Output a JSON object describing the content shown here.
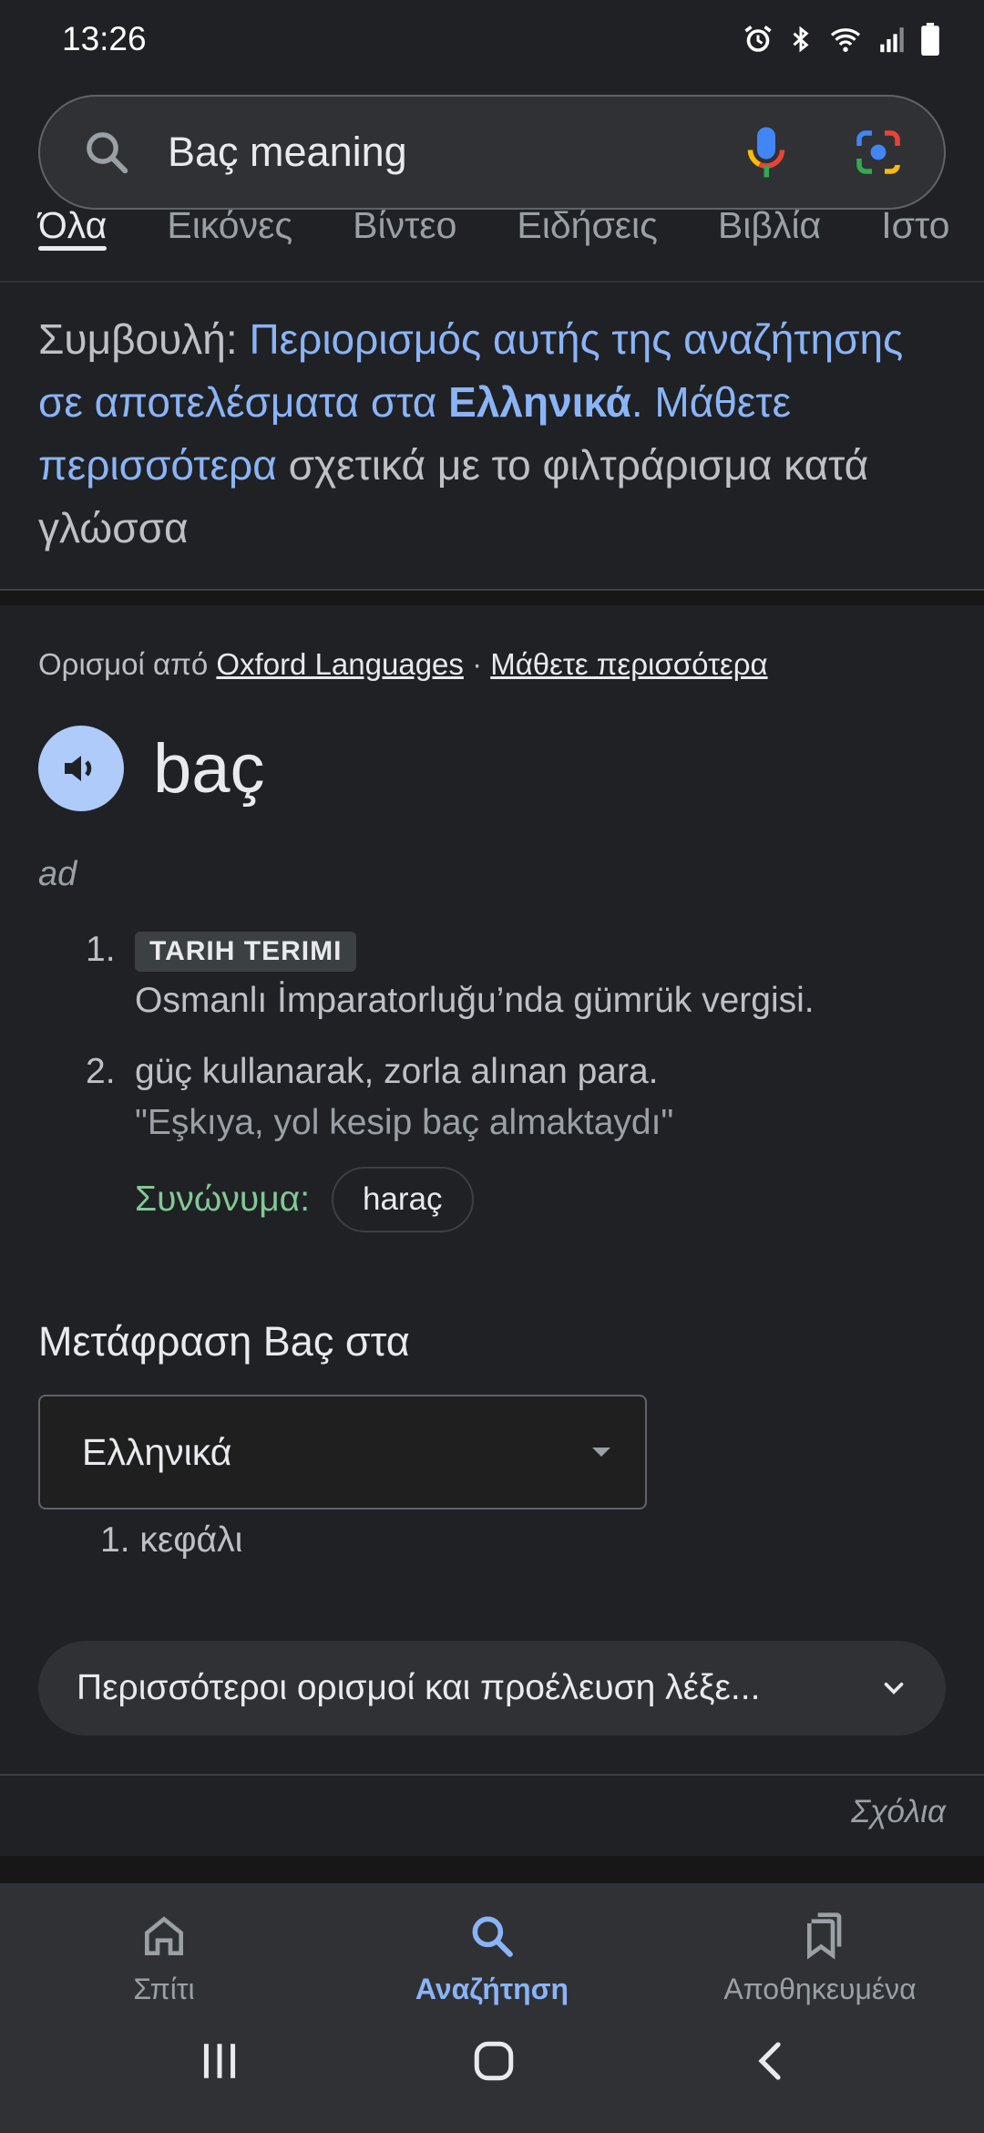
{
  "status_bar": {
    "time": "13:26",
    "icons": [
      "alarm-icon",
      "bluetooth-icon",
      "wifi-icon",
      "signal-icon",
      "battery-icon"
    ]
  },
  "search": {
    "query": "Baç meaning",
    "icons": [
      "search-icon",
      "mic-icon",
      "lens-icon"
    ]
  },
  "tabs": [
    {
      "label": "Όλα",
      "active": true
    },
    {
      "label": "Εικόνες"
    },
    {
      "label": "Βίντεο"
    },
    {
      "label": "Ειδήσεις"
    },
    {
      "label": "Βιβλία"
    },
    {
      "label": "Ιστο"
    }
  ],
  "tip": {
    "prefix": "Συμβουλή: ",
    "link1": "Περιορισμός αυτής της αναζήτησης σε αποτελέσματα στα ",
    "lang": "Ελληνικά",
    "sep": ". ",
    "link2": "Μάθετε περισσότερα",
    "suffix": " σχετικά με το φιλτράρισμα κατά γλώσσα"
  },
  "dictionary": {
    "source_prefix": "Ορισμοί από ",
    "source": "Oxford Languages",
    "dot": " · ",
    "learn_more": "Μάθετε περισσότερα",
    "word": "baç",
    "part_of_speech": "ad",
    "definitions": [
      {
        "num": "1.",
        "tag": "TARIH TERIMI",
        "text": "Osmanlı İmparatorluğu’nda gümrük vergisi."
      },
      {
        "num": "2.",
        "text": "güç kullanarak, zorla alınan para.",
        "example": "\"Eşkıya, yol kesip baç almaktaydı\""
      }
    ],
    "synonyms_label": "Συνώνυμα:",
    "synonyms": [
      "haraç"
    ]
  },
  "translation": {
    "title": "Μετάφραση Baç στα",
    "selected_language": "Ελληνικά",
    "results": [
      "1. κεφάλι"
    ]
  },
  "more_definitions": "Περισσότεροι ορισμοί και προέλευση λέξε...",
  "feedback": "Σχόλια",
  "bottom_nav": [
    {
      "label": "Σπίτι",
      "icon": "home-icon"
    },
    {
      "label": "Αναζήτηση",
      "icon": "search-icon",
      "active": true
    },
    {
      "label": "Αποθηκευμένα",
      "icon": "bookmarks-icon"
    }
  ],
  "colors": {
    "background": "#202124",
    "accent": "#8ab4f8",
    "synonym_green": "#81c995"
  }
}
